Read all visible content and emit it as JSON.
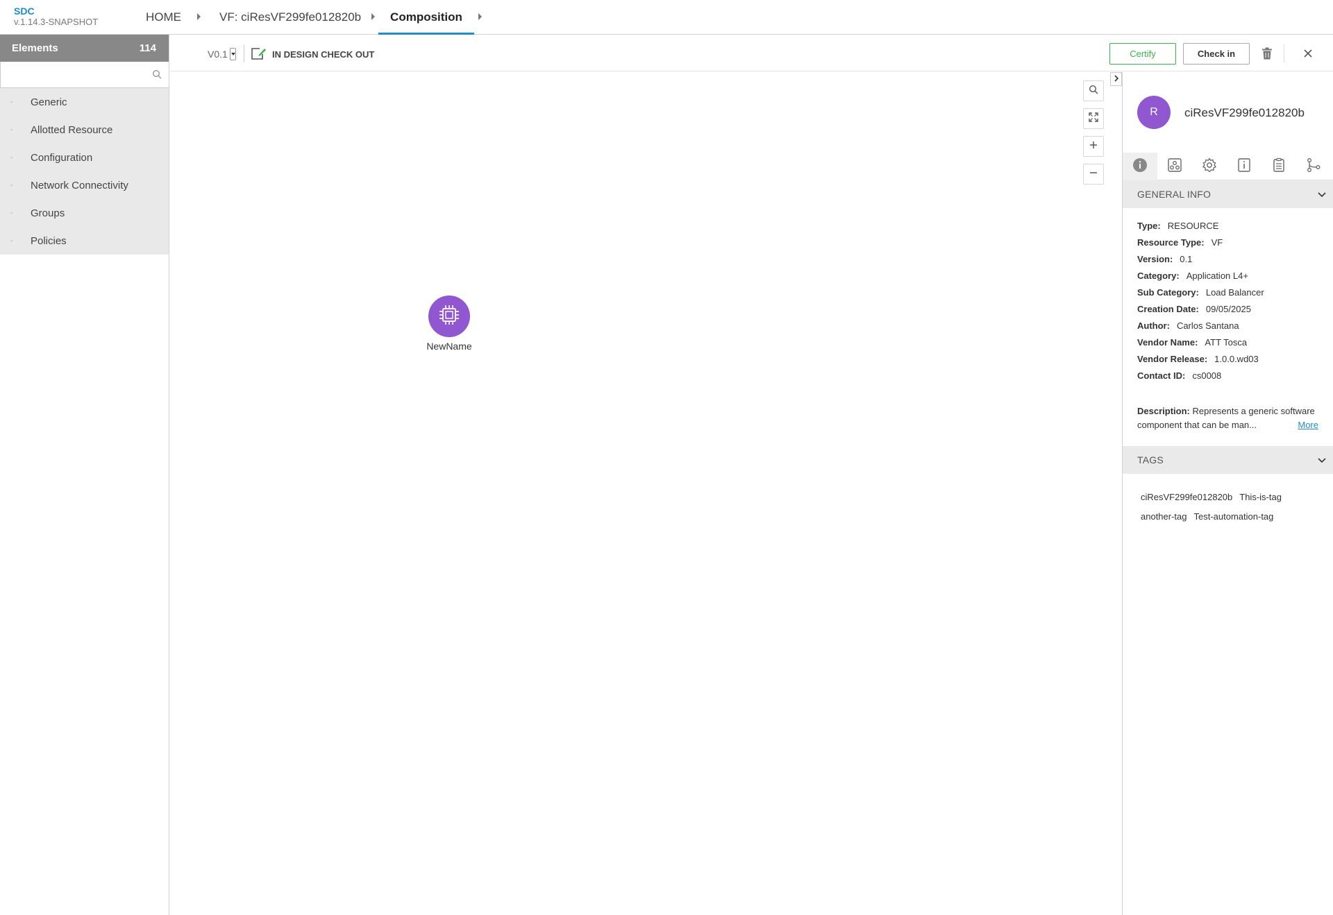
{
  "brand": {
    "name": "SDC",
    "version": "v.1.14.3-SNAPSHOT"
  },
  "breadcrumb": {
    "home": "HOME",
    "vf": "VF: ciResVF299fe012820b",
    "composition": "Composition"
  },
  "palette": {
    "title": "Elements",
    "count": "114",
    "search_placeholder": "",
    "groups": [
      "Generic",
      "Allotted Resource",
      "Configuration",
      "Network Connectivity",
      "Groups",
      "Policies"
    ]
  },
  "toolbar": {
    "version": "V0.1",
    "status": "IN DESIGN CHECK OUT",
    "certify_label": "Certify",
    "checkin_label": "Check in"
  },
  "canvas": {
    "node_label": "NewName"
  },
  "right_panel": {
    "avatar_letter": "R",
    "title": "ciResVF299fe012820b",
    "tab_icons": [
      "info-icon",
      "composition-icon",
      "settings-icon",
      "info-box-icon",
      "clipboard-icon",
      "relations-icon"
    ],
    "general_info": {
      "header": "GENERAL INFO",
      "fields": [
        {
          "label": "Type:",
          "value": "RESOURCE"
        },
        {
          "label": "Resource Type:",
          "value": "VF"
        },
        {
          "label": "Version:",
          "value": "0.1"
        },
        {
          "label": "Category:",
          "value": "Application L4+"
        },
        {
          "label": "Sub Category:",
          "value": "Load Balancer"
        },
        {
          "label": "Creation Date:",
          "value": "09/05/2025"
        },
        {
          "label": "Author:",
          "value": "Carlos Santana"
        },
        {
          "label": "Vendor Name:",
          "value": "ATT Tosca"
        },
        {
          "label": "Vendor Release:",
          "value": "1.0.0.wd03"
        },
        {
          "label": "Contact ID:",
          "value": "cs0008"
        }
      ],
      "description_label": "Description:",
      "description": "Represents a generic software component that can be man...",
      "more_label": "More"
    },
    "tags": {
      "header": "TAGS",
      "items": [
        "ciResVF299fe012820b",
        "This-is-tag",
        "another-tag",
        "Test-automation-tag"
      ]
    }
  },
  "colors": {
    "accent": "#1f8ccb",
    "node": "#9057d1",
    "certify": "#3ab34a",
    "palette_header": "#888888"
  }
}
